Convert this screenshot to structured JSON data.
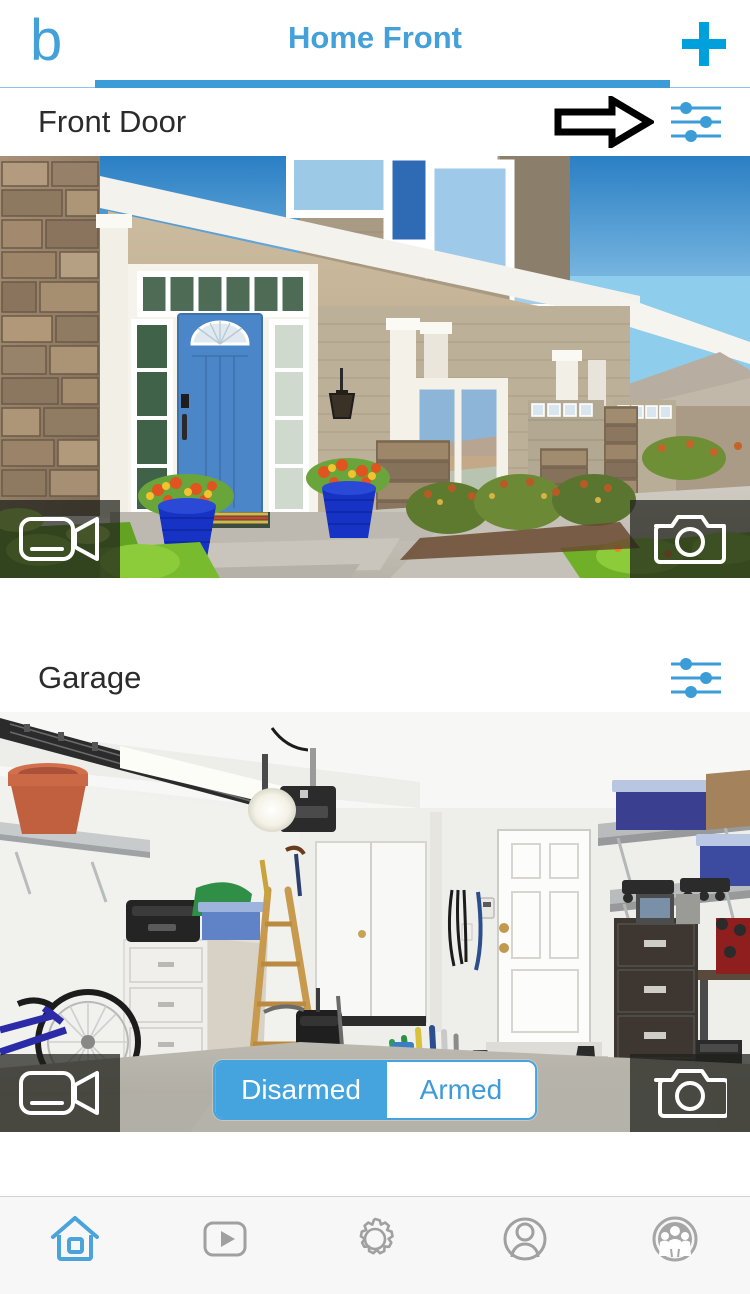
{
  "app": {
    "brand_logo_text": "b",
    "header_title": "Home Front",
    "add_button_label": "+",
    "accent_blue": "#44a0d9",
    "accent_bright_blue": "#00a0dc",
    "tab_indicator_color": "#3b9cd7"
  },
  "icons": {
    "brand": "letter-b-logo",
    "add": "plus-icon",
    "settings_sliders": "sliders-icon",
    "pointer": "right-arrow-annotation",
    "record_video": "video-camera-icon",
    "take_photo": "photo-camera-icon"
  },
  "cameras": [
    {
      "name": "Front Door",
      "has_pointer_arrow": true,
      "settings_icon": "sliders-icon",
      "record_label": "video-camera-icon",
      "snapshot_label": "photo-camera-icon",
      "scene": "front-door-porch-blue-door"
    },
    {
      "name": "Garage",
      "has_pointer_arrow": false,
      "settings_icon": "sliders-icon",
      "record_label": "video-camera-icon",
      "snapshot_label": "photo-camera-icon",
      "scene": "garage-interior"
    }
  ],
  "arm_control": {
    "options": [
      "Disarmed",
      "Armed"
    ],
    "selected": "Disarmed",
    "disarmed_label": "Disarmed",
    "armed_label": "Armed",
    "selected_bg": "#45a3dd",
    "selected_text": "#ffffff",
    "unselected_text": "#3f9ada"
  },
  "bottom_nav": {
    "active_index": 0,
    "active_color": "#4aa3db",
    "inactive_color": "#9b9b9b",
    "items": [
      {
        "name": "home",
        "icon": "home-icon",
        "active": true
      },
      {
        "name": "clips",
        "icon": "play-icon",
        "active": false
      },
      {
        "name": "settings",
        "icon": "gear-icon",
        "active": false
      },
      {
        "name": "account",
        "icon": "person-icon",
        "active": false
      },
      {
        "name": "family",
        "icon": "group-icon",
        "active": false
      }
    ]
  }
}
